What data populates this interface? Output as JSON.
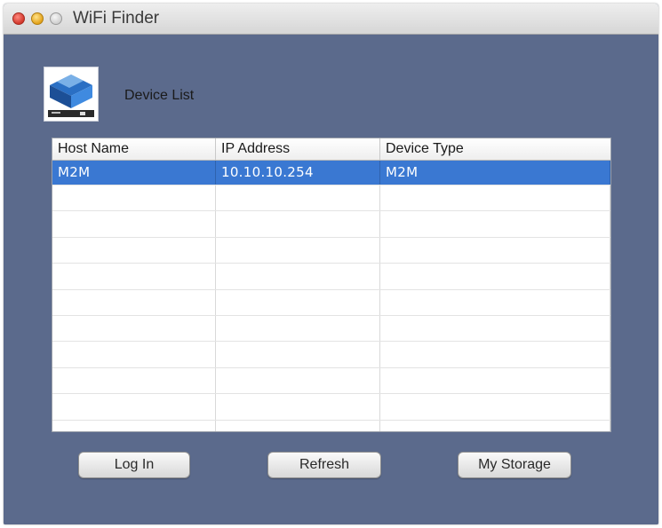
{
  "window": {
    "title": "WiFi Finder"
  },
  "header": {
    "label": "Device List",
    "logo_icon": "wifi-finder-logo-icon"
  },
  "table": {
    "columns": [
      "Host Name",
      "IP Address",
      "Device Type"
    ],
    "rows": [
      [
        "M2M",
        "10.10.10.254",
        "M2M"
      ]
    ],
    "selected_row": 0
  },
  "buttons": {
    "login": "Log In",
    "refresh": "Refresh",
    "storage": "My Storage"
  },
  "colors": {
    "background": "#5b6a8c",
    "selection": "#3a78d2"
  }
}
